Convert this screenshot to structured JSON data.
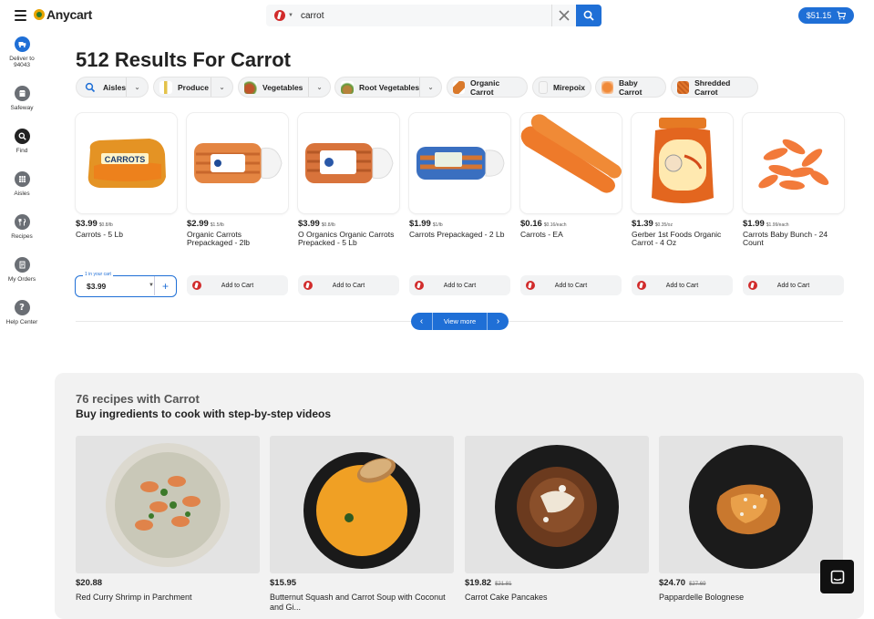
{
  "header": {
    "logo_text": "Anycart",
    "search_value": "carrot",
    "cart_total": "$51.15",
    "accent": "#1f6fd6"
  },
  "sidebar": {
    "items": [
      {
        "label": "Deliver to 94043",
        "icon": "delivery-icon"
      },
      {
        "label": "Safeway",
        "icon": "store-icon"
      },
      {
        "label": "Find",
        "icon": "search-icon"
      },
      {
        "label": "Aisles",
        "icon": "grid-icon"
      },
      {
        "label": "Recipes",
        "icon": "chef-icon"
      },
      {
        "label": "My Orders",
        "icon": "orders-icon"
      },
      {
        "label": "Help Center",
        "icon": "help-icon"
      }
    ]
  },
  "results": {
    "title": "512 Results For Carrot"
  },
  "chips": [
    {
      "label": "Aisles",
      "dropdown": true
    },
    {
      "label": "Produce",
      "dropdown": true
    },
    {
      "label": "Vegetables",
      "dropdown": true
    },
    {
      "label": "Root Vegetables",
      "dropdown": true
    },
    {
      "label": "Organic Carrot",
      "dropdown": false
    },
    {
      "label": "Mirepoix",
      "dropdown": false
    },
    {
      "label": "Baby Carrot",
      "dropdown": false
    },
    {
      "label": "Shredded Carrot",
      "dropdown": false
    }
  ],
  "products": [
    {
      "price": "$3.99",
      "unit": "$0.8/lb",
      "name": "Carrots - 5 Lb"
    },
    {
      "price": "$2.99",
      "unit": "$1.5/lb",
      "name": "Organic Carrots Prepackaged - 2lb"
    },
    {
      "price": "$3.99",
      "unit": "$0.8/lb",
      "name": "O Organics Organic Carrots Prepacked - 5 Lb"
    },
    {
      "price": "$1.99",
      "unit": "$1/lb",
      "name": "Carrots Prepackaged - 2 Lb"
    },
    {
      "price": "$0.16",
      "unit": "$0.16/each",
      "name": "Carrots - EA"
    },
    {
      "price": "$1.39",
      "unit": "$0.35/oz",
      "name": "Gerber 1st Foods Organic Carrot - 4 Oz"
    },
    {
      "price": "$1.99",
      "unit": "$1.99/each",
      "name": "Carrots Baby Bunch - 24 Count"
    }
  ],
  "in_cart": {
    "tag": "1 in your cart",
    "value": "$3.99"
  },
  "add_to_cart_label": "Add to Cart",
  "view_more": "View more",
  "recipes": {
    "count": "76 recipes with Carrot",
    "subtitle": "Buy ingredients to cook with step-by-step videos",
    "items": [
      {
        "price": "$20.88",
        "old_price": "",
        "name": "Red Curry Shrimp in Parchment"
      },
      {
        "price": "$15.95",
        "old_price": "",
        "name": "Butternut Squash and Carrot Soup with Coconut and Gi..."
      },
      {
        "price": "$19.82",
        "old_price": "$21.81",
        "name": "Carrot Cake Pancakes"
      },
      {
        "price": "$24.70",
        "old_price": "$27.69",
        "name": "Pappardelle Bolognese"
      }
    ]
  }
}
